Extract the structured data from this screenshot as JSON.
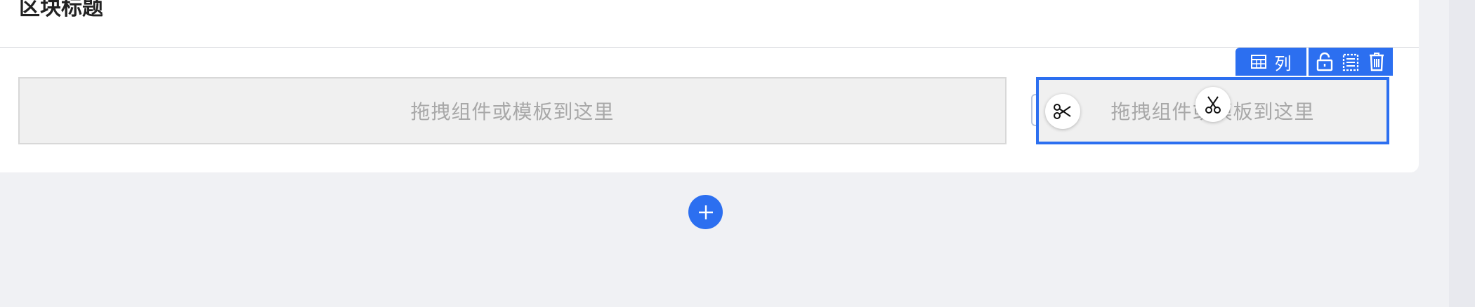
{
  "section": {
    "title": "区块标题"
  },
  "columns": [
    {
      "placeholder": "拖拽组件或模板到这里"
    },
    {
      "placeholder": "拖拽组件或模板到这里"
    }
  ],
  "column_toolbar": {
    "badge_label": "列",
    "badge_icon": "table-icon",
    "actions": [
      "lock-icon",
      "copy-icon",
      "trash-icon"
    ]
  },
  "floating_actions": [
    "scissors-icon",
    "scissors-icon"
  ],
  "add_section_icon": "plus-icon",
  "colors": {
    "accent": "#2c6ff0",
    "background": "#f0f1f4",
    "dropzone": "#f0f0f0",
    "placeholder_text": "#a8a8a8"
  }
}
